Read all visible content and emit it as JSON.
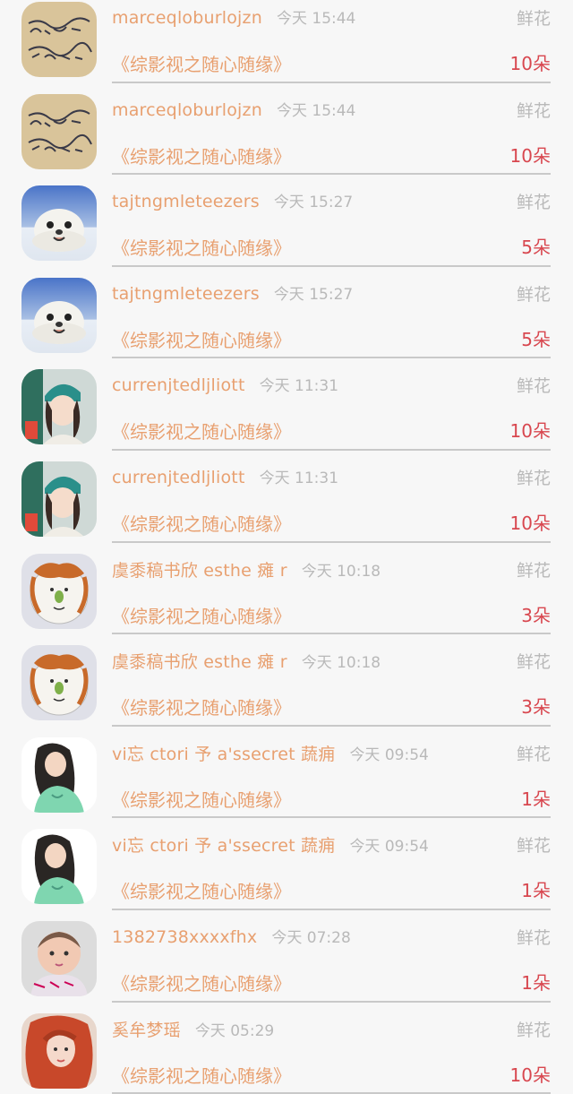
{
  "rows": [
    {
      "username": "marceqloburlojzn",
      "time": "今天 15:44",
      "gift": "鲜花",
      "title": "《综影视之随心随缘》",
      "count": "10朵",
      "avatar": "paper"
    },
    {
      "username": "marceqloburlojzn",
      "time": "今天 15:44",
      "gift": "鲜花",
      "title": "《综影视之随心随缘》",
      "count": "10朵",
      "avatar": "paper"
    },
    {
      "username": "tajtngmleteezers",
      "time": "今天 15:27",
      "gift": "鲜花",
      "title": "《综影视之随心随缘》",
      "count": "5朵",
      "avatar": "seal"
    },
    {
      "username": "tajtngmleteezers",
      "time": "今天 15:27",
      "gift": "鲜花",
      "title": "《综影视之随心随缘》",
      "count": "5朵",
      "avatar": "seal"
    },
    {
      "username": "currenjtedljliott",
      "time": "今天 11:31",
      "gift": "鲜花",
      "title": "《综影视之随心随缘》",
      "count": "10朵",
      "avatar": "girl-hat"
    },
    {
      "username": "currenjtedljliott",
      "time": "今天 11:31",
      "gift": "鲜花",
      "title": "《综影视之随心随缘》",
      "count": "10朵",
      "avatar": "girl-hat"
    },
    {
      "username": "虞黍稿书欣 esthe 瘫 r",
      "time": "今天 10:18",
      "gift": "鲜花",
      "title": "《综影视之随心随缘》",
      "count": "3朵",
      "avatar": "cartoon-plate"
    },
    {
      "username": "虞黍稿书欣 esthe 瘫 r",
      "time": "今天 10:18",
      "gift": "鲜花",
      "title": "《综影视之随心随缘》",
      "count": "3朵",
      "avatar": "cartoon-plate"
    },
    {
      "username": "vi忘 ctori 予 a'ssecret 蔬痈",
      "time": "今天 09:54",
      "gift": "鲜花",
      "title": "《综影视之随心随缘》",
      "count": "1朵",
      "avatar": "girl-green"
    },
    {
      "username": "vi忘 ctori 予 a'ssecret 蔬痈",
      "time": "今天 09:54",
      "gift": "鲜花",
      "title": "《综影视之随心随缘》",
      "count": "1朵",
      "avatar": "girl-green"
    },
    {
      "username": "1382738xxxxfhx",
      "time": "今天 07:28",
      "gift": "鲜花",
      "title": "《综影视之随心随缘》",
      "count": "1朵",
      "avatar": "baby"
    },
    {
      "username": "奚牟梦瑶",
      "time": "今天 05:29",
      "gift": "鲜花",
      "title": "《综影视之随心随缘》",
      "count": "10朵",
      "avatar": "redhead"
    }
  ],
  "colors": {
    "name": "#e8a070",
    "time": "#b9b9b9",
    "count": "#d8474f",
    "divider": "#c9c9c9",
    "background": "#f7f7f7"
  }
}
